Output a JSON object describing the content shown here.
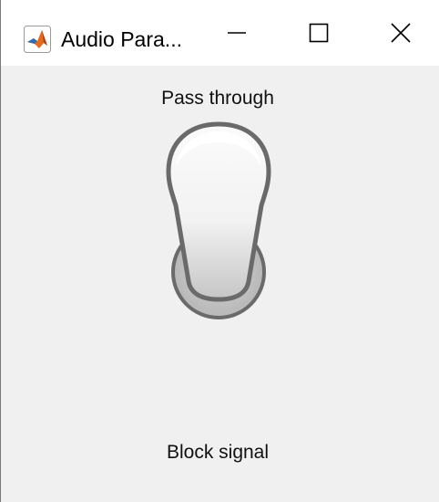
{
  "window": {
    "title": "Audio Para...",
    "controls": {
      "minimize": "minimize",
      "maximize": "maximize",
      "close": "close"
    }
  },
  "switch": {
    "top_label": "Pass through",
    "bottom_label": "Block signal",
    "state": "Pass through",
    "colors": {
      "lever_outline": "#6a6a6a",
      "lever_fill_top": "#fbfbfb",
      "lever_fill_bottom": "#c8c8c8",
      "base_ring": "#bcbcbc",
      "background": "#f0f0f0"
    }
  }
}
